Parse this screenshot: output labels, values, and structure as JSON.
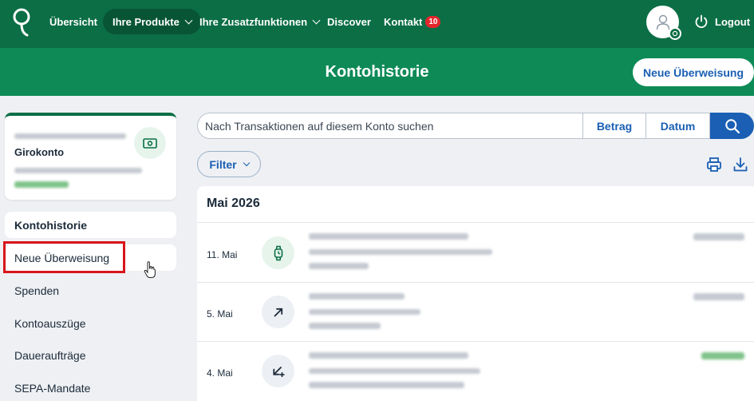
{
  "nav": {
    "items": [
      {
        "label": "Übersicht"
      },
      {
        "label": "Ihre Produkte"
      },
      {
        "label": "Ihre Zusatzfunktionen"
      },
      {
        "label": "Discover"
      },
      {
        "label": "Kontakt",
        "badge": "10"
      }
    ],
    "logout_label": "Logout"
  },
  "banner": {
    "title": "Kontohistorie",
    "new_transfer_label": "Neue Überweisung"
  },
  "account": {
    "name": "Girokonto"
  },
  "sidebar": {
    "items": [
      {
        "label": "Kontohistorie",
        "active": true
      },
      {
        "label": "Neue Überweisung",
        "highlighted": true
      },
      {
        "label": "Spenden"
      },
      {
        "label": "Kontoauszüge"
      },
      {
        "label": "Daueraufträge"
      },
      {
        "label": "SEPA-Mandate"
      }
    ]
  },
  "search": {
    "placeholder": "Nach Transaktionen auf diesem Konto suchen",
    "amount_label": "Betrag",
    "date_label": "Datum"
  },
  "filter": {
    "label": "Filter"
  },
  "transactions": {
    "month": "Mai 2026",
    "rows": [
      {
        "date": "11. Mai",
        "icon": "watch-icon"
      },
      {
        "date": "5. Mai",
        "icon": "arrow-outgoing-icon"
      },
      {
        "date": "4. Mai",
        "icon": "arrow-incoming-icon"
      }
    ]
  },
  "colors": {
    "primary_green": "#0b6e45",
    "banner_green": "#0e8a57",
    "accent_blue": "#1a5fb4",
    "highlight_red": "#d8151b"
  }
}
